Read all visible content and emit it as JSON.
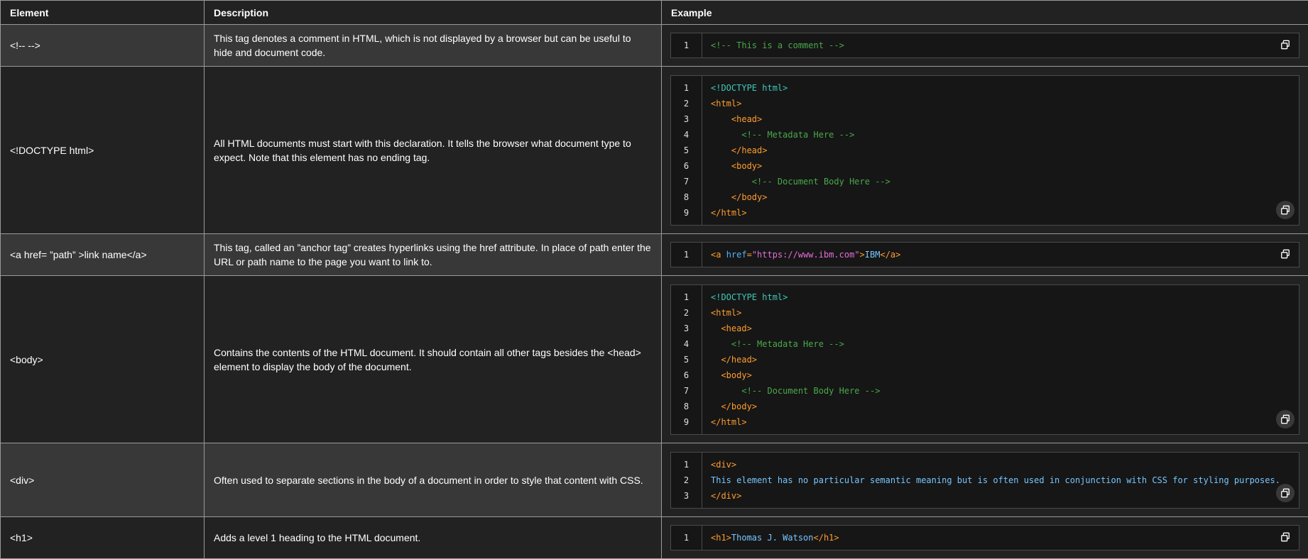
{
  "headers": {
    "element": "Element",
    "description": "Description",
    "example": "Example"
  },
  "rows": [
    {
      "element": "<!--  -->",
      "description": "This tag denotes a comment in HTML, which is not displayed by a browser but can be useful to hide and document code.",
      "code": [
        [
          {
            "t": "cm",
            "v": "<!-- This is a comment -->"
          }
        ]
      ]
    },
    {
      "element": "<!DOCTYPE html>",
      "description": "All HTML documents must start with this declaration. It tells the browser what document type to expect. Note that this element has no ending tag.",
      "code": [
        [
          {
            "t": "dt",
            "v": "<!DOCTYPE html>"
          }
        ],
        [
          {
            "t": "tag",
            "v": "<html>"
          }
        ],
        [
          {
            "t": "pl",
            "v": "    "
          },
          {
            "t": "tag",
            "v": "<head>"
          }
        ],
        [
          {
            "t": "pl",
            "v": "      "
          },
          {
            "t": "cm",
            "v": "<!-- Metadata Here -->"
          }
        ],
        [
          {
            "t": "pl",
            "v": "    "
          },
          {
            "t": "tag",
            "v": "</head>"
          }
        ],
        [
          {
            "t": "pl",
            "v": "    "
          },
          {
            "t": "tag",
            "v": "<body>"
          }
        ],
        [
          {
            "t": "pl",
            "v": "        "
          },
          {
            "t": "cm",
            "v": "<!-- Document Body Here -->"
          }
        ],
        [
          {
            "t": "pl",
            "v": "    "
          },
          {
            "t": "tag",
            "v": "</body>"
          }
        ],
        [
          {
            "t": "tag",
            "v": "</html>"
          }
        ]
      ]
    },
    {
      "element": "<a href= ”path” >link name</a>",
      "description": "This tag, called an ”anchor tag” creates hyperlinks using the href attribute. In place of path enter the URL or path name to the page you want to link to.",
      "code": [
        [
          {
            "t": "tag",
            "v": "<a "
          },
          {
            "t": "at",
            "v": "href"
          },
          {
            "t": "tag",
            "v": "="
          },
          {
            "t": "st",
            "v": "\"https://www.ibm.com\""
          },
          {
            "t": "tag",
            "v": ">"
          },
          {
            "t": "tx",
            "v": "IBM"
          },
          {
            "t": "tag",
            "v": "</a>"
          }
        ]
      ]
    },
    {
      "element": "<body>",
      "description": "Contains the contents of the HTML document. It should contain all other tags besides the <head> element to display the body of the document.",
      "code": [
        [
          {
            "t": "dt",
            "v": "<!DOCTYPE html>"
          }
        ],
        [
          {
            "t": "tag",
            "v": "<html>"
          }
        ],
        [
          {
            "t": "pl",
            "v": "  "
          },
          {
            "t": "tag",
            "v": "<head>"
          }
        ],
        [
          {
            "t": "pl",
            "v": "    "
          },
          {
            "t": "cm",
            "v": "<!-- Metadata Here -->"
          }
        ],
        [
          {
            "t": "pl",
            "v": "  "
          },
          {
            "t": "tag",
            "v": "</head>"
          }
        ],
        [
          {
            "t": "pl",
            "v": "  "
          },
          {
            "t": "tag",
            "v": "<body>"
          }
        ],
        [
          {
            "t": "pl",
            "v": "      "
          },
          {
            "t": "cm",
            "v": "<!-- Document Body Here -->"
          }
        ],
        [
          {
            "t": "pl",
            "v": "  "
          },
          {
            "t": "tag",
            "v": "</body>"
          }
        ],
        [
          {
            "t": "tag",
            "v": "</html>"
          }
        ]
      ]
    },
    {
      "element": "<div>",
      "description": "Often used to separate sections in the body of a document in order to style that content with CSS.",
      "code": [
        [
          {
            "t": "tag",
            "v": "<div>"
          }
        ],
        [
          {
            "t": "tx",
            "v": "This element has no particular semantic meaning but is often used in conjunction with CSS for styling purposes."
          }
        ],
        [
          {
            "t": "tag",
            "v": "</div>"
          }
        ]
      ]
    },
    {
      "element": "<h1>",
      "description": "Adds a level 1 heading to the HTML document.",
      "code": [
        [
          {
            "t": "tag",
            "v": "<h1>"
          },
          {
            "t": "tx",
            "v": "Thomas J. Watson"
          },
          {
            "t": "tag",
            "v": "</h1>"
          }
        ]
      ]
    }
  ],
  "icons": {
    "copy": "copy-icon"
  },
  "colors": {
    "tag": "#ff9d2e",
    "comment": "#49a84a",
    "doctype": "#3fc8b8",
    "attr": "#4fb3ff",
    "string": "#e36dd6",
    "text": "#77c6ff"
  }
}
